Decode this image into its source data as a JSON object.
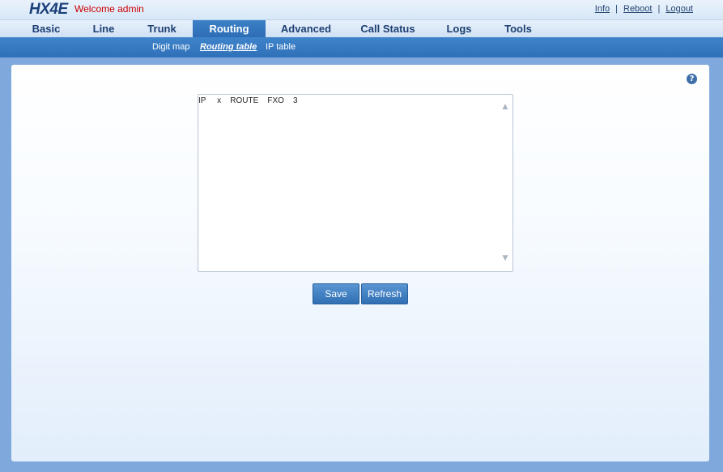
{
  "header": {
    "logo": "HX4E",
    "welcome": "Welcome admin",
    "links": [
      "Info",
      "Reboot",
      "Logout"
    ],
    "separator": "|"
  },
  "nav": {
    "items": [
      "Basic",
      "Line",
      "Trunk",
      "Routing",
      "Advanced",
      "Call Status",
      "Logs",
      "Tools"
    ],
    "active": "Routing"
  },
  "subnav": {
    "items": [
      "Digit map",
      "Routing table",
      "IP table"
    ],
    "active": "Routing table"
  },
  "routing_table": {
    "content": "IP     x    ROUTE    FXO    3"
  },
  "buttons": {
    "save": "Save",
    "refresh": "Refresh"
  },
  "icons": {
    "help": "help-icon",
    "scroll_up": "chevron-up-icon",
    "scroll_down": "chevron-down-icon"
  },
  "colors": {
    "accent": "#2f70b8",
    "welcome_text": "#cc0000",
    "logo": "#1c3f7a"
  }
}
